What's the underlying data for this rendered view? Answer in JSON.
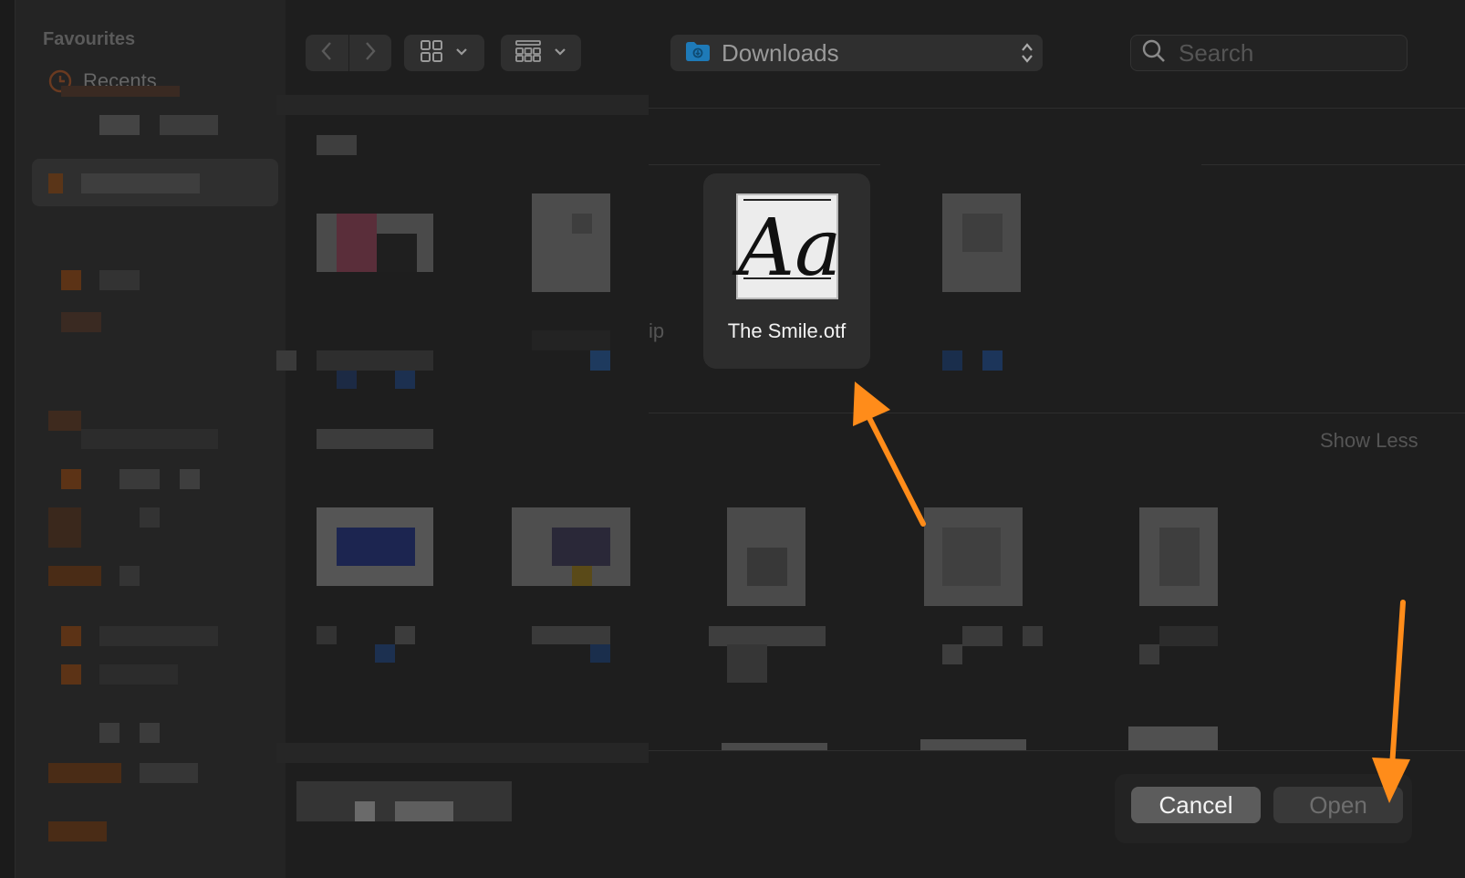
{
  "sidebar": {
    "heading": "Favourites",
    "recents_label": "Recents"
  },
  "toolbar": {
    "back_icon": "chevron-left-icon",
    "forward_icon": "chevron-right-icon",
    "view_mode_icon": "grid-icon",
    "group_by_icon": "group-grid-icon",
    "location": "Downloads",
    "search_placeholder": "Search"
  },
  "files": {
    "selected_name": "The Smile.otf",
    "selected_thumb_glyph": "Aa",
    "partial_label": "ip"
  },
  "section": {
    "show_less": "Show Less"
  },
  "footer": {
    "cancel_label": "Cancel",
    "open_label": "Open"
  },
  "annotation_color": "#FF8C1A",
  "folder_color": "#1e7ab8"
}
